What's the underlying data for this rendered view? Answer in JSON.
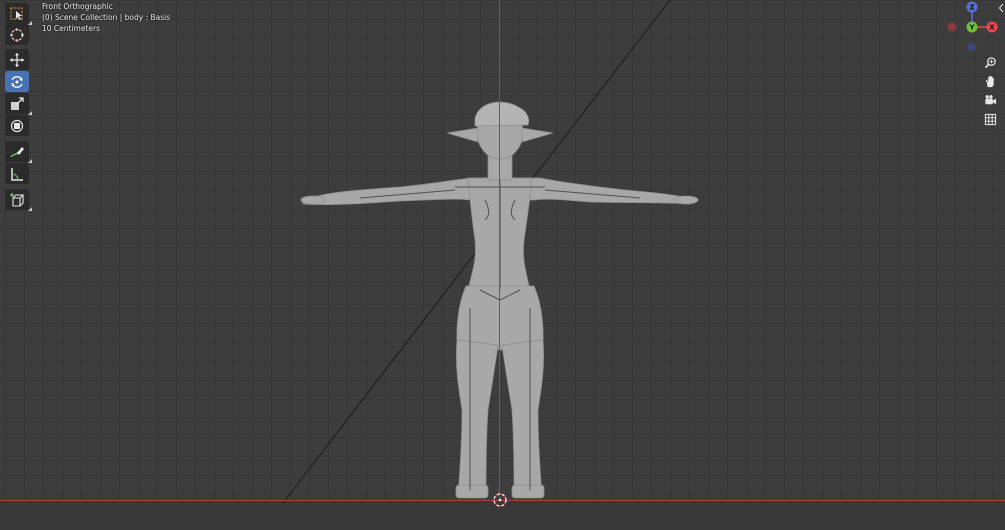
{
  "viewport": {
    "view_name": "Front Orthographic",
    "collection_info": "(0) Scene Collection | body : Basis",
    "grid_scale": "10 Centimeters"
  },
  "toolbar": {
    "active_tool": "rotate-tool",
    "tools": [
      "select-box",
      "cursor",
      "move",
      "rotate",
      "scale",
      "transform",
      "annotate",
      "measure",
      "add-cube"
    ]
  },
  "navigation_gizmo": {
    "x_label": "X",
    "y_label": "Y",
    "z_label": "Z"
  },
  "colors": {
    "background": "#3d3d3d",
    "x_axis": "#e8484c",
    "y_axis": "#6bc23a",
    "z_axis": "#5a6fd6",
    "active_tool": "#4772b3"
  }
}
